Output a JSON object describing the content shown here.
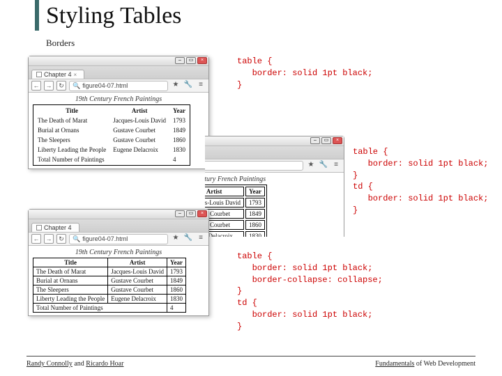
{
  "slide": {
    "title": "Styling Tables",
    "subtitle": "Borders"
  },
  "browser": {
    "tab_label": "Chapter 4",
    "address": "figure04-07.html",
    "caption": "19th Century French Paintings"
  },
  "table": {
    "headers": {
      "title": "Title",
      "artist": "Artist",
      "year": "Year"
    },
    "rows": [
      {
        "title": "The Death of Marat",
        "artist": "Jacques-Louis David",
        "year": "1793"
      },
      {
        "title": "Burial at Ornans",
        "artist": "Gustave Courbet",
        "year": "1849"
      },
      {
        "title": "The Sleepers",
        "artist": "Gustave Courbet",
        "year": "1860"
      },
      {
        "title": "Liberty Leading the People",
        "artist": "Eugene Delacroix",
        "year": "1830"
      }
    ],
    "footer": {
      "label": "Total Number of Paintings",
      "value": "4"
    }
  },
  "code": {
    "snippet1": "table {\n   border: solid 1pt black;\n}",
    "snippet2": "table {\n   border: solid 1pt black;\n}\ntd {\n   border: solid 1pt black;\n}",
    "snippet3": "table {\n   border: solid 1pt black;\n   border-collapse: collapse;\n}\ntd {\n   border: solid 1pt black;\n}"
  },
  "footer": {
    "author1": "Randy Connolly",
    "author_sep": " and ",
    "author2": "Ricardo Hoar",
    "right1": "Fundamentals",
    "right2": " of Web Development"
  },
  "icons": {
    "back": "←",
    "fwd": "→",
    "reload": "↻",
    "search": "🔍",
    "star": "★",
    "wrench": "🔧",
    "menu": "≡",
    "close": "×",
    "min": "–",
    "max": "▭"
  }
}
